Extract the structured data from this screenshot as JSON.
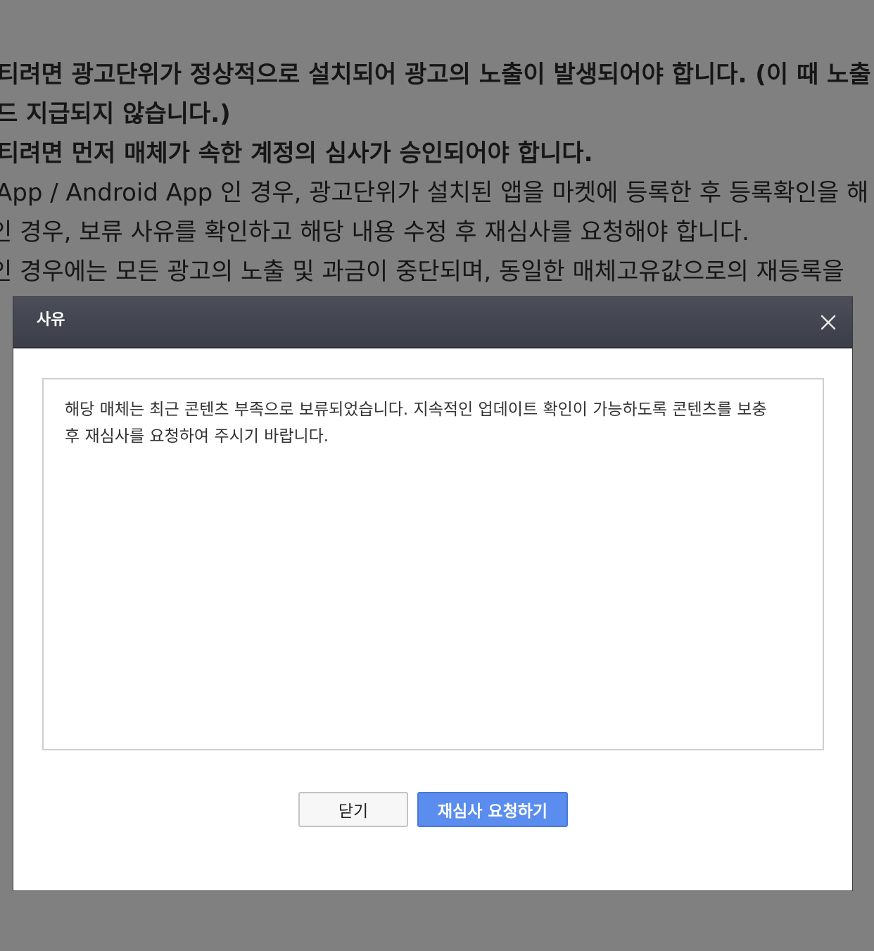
{
  "background": {
    "lines": [
      "티려면 광고단위가 정상적으로 설치되어 광고의 노출이 발생되어야 합니다. (이 때 노출",
      "드 지급되지 않습니다.)",
      "티려면 먼저 매체가 속한 계정의 심사가 승인되어야 합니다.",
      "App / Android App 인 경우, 광고단위가 설치된 앱을 마켓에 등록한 후 등록확인을 해",
      "인 경우, 보류 사유를 확인하고 해당 내용 수정 후 재심사를 요청해야 합니다.",
      "인 경우에는 모든 광고의 노출 및 과금이 중단되며, 동일한 매체고유값으로의 재등록을"
    ]
  },
  "modal": {
    "title": "사유",
    "close_icon": "close-x-icon",
    "reason_lines": [
      "해당 매체는 최근 콘텐츠 부족으로 보류되었습니다. 지속적인 업데이트 확인이 가능하도록 콘텐츠를 보충",
      "후 재심사를 요청하여 주시기 바랍니다."
    ],
    "buttons": {
      "close_label": "닫기",
      "request_label": "재심사 요청하기"
    }
  },
  "colors": {
    "overlay": "#808080",
    "header": "#43464f",
    "primary_button": "#5a8dee"
  }
}
